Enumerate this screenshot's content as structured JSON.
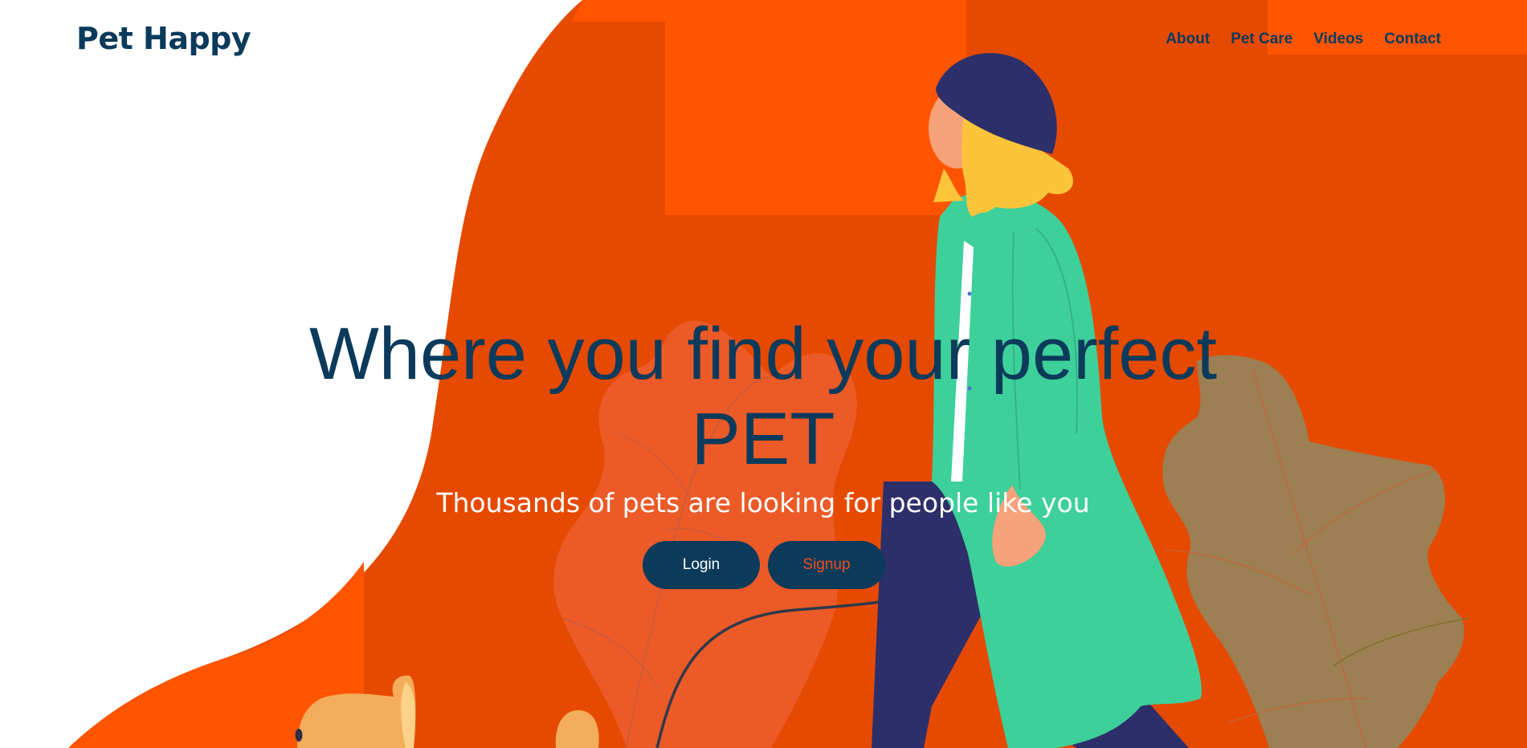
{
  "brand": {
    "name": "Pet Happy"
  },
  "nav": {
    "items": [
      {
        "label": "About"
      },
      {
        "label": "Pet Care"
      },
      {
        "label": "Videos"
      },
      {
        "label": "Contact"
      }
    ]
  },
  "hero": {
    "title_line1": "Where you find your perfect",
    "title_line2": "PET",
    "subtitle": "Thousands of pets are looking for people like you",
    "login_label": "Login",
    "signup_label": "Signup"
  },
  "colors": {
    "accent_orange": "#e64a00",
    "bright_orange": "#ff5500",
    "navy": "#0b3a5b",
    "coat_green": "#3dd09a",
    "leaf_brown": "#9c7f52"
  }
}
